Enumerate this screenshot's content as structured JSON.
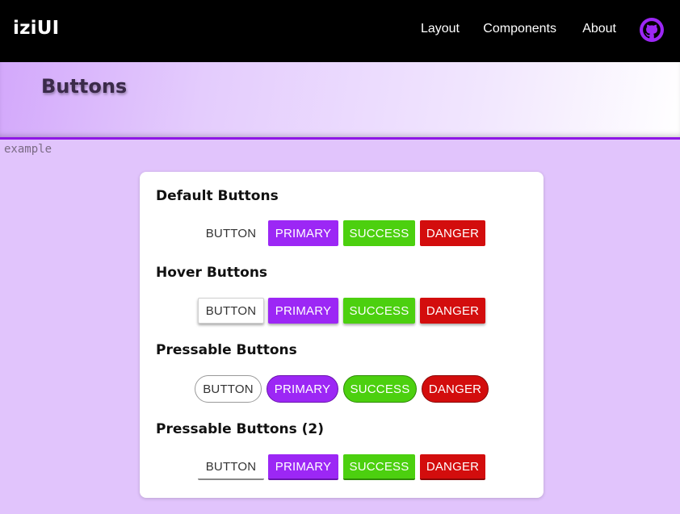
{
  "nav": {
    "brand": "iziUI",
    "links": [
      "Layout",
      "Components",
      "About"
    ],
    "github_icon": "github-icon"
  },
  "header": {
    "title": "Buttons",
    "tag": "example"
  },
  "sections": [
    {
      "title": "Default Buttons",
      "buttons": [
        "BUTTON",
        "PRIMARY",
        "SUCCESS",
        "DANGER"
      ]
    },
    {
      "title": "Hover Buttons",
      "buttons": [
        "BUTTON",
        "PRIMARY",
        "SUCCESS",
        "DANGER"
      ]
    },
    {
      "title": "Pressable Buttons",
      "buttons": [
        "BUTTON",
        "PRIMARY",
        "SUCCESS",
        "DANGER"
      ]
    },
    {
      "title": "Pressable Buttons (2)",
      "buttons": [
        "BUTTON",
        "PRIMARY",
        "SUCCESS",
        "DANGER"
      ]
    }
  ],
  "colors": {
    "primary": "#9c27f5",
    "success": "#4cd00f",
    "danger": "#d30d0d",
    "accent_line": "#8f17e6",
    "page_bg": "#e1c4fc"
  }
}
